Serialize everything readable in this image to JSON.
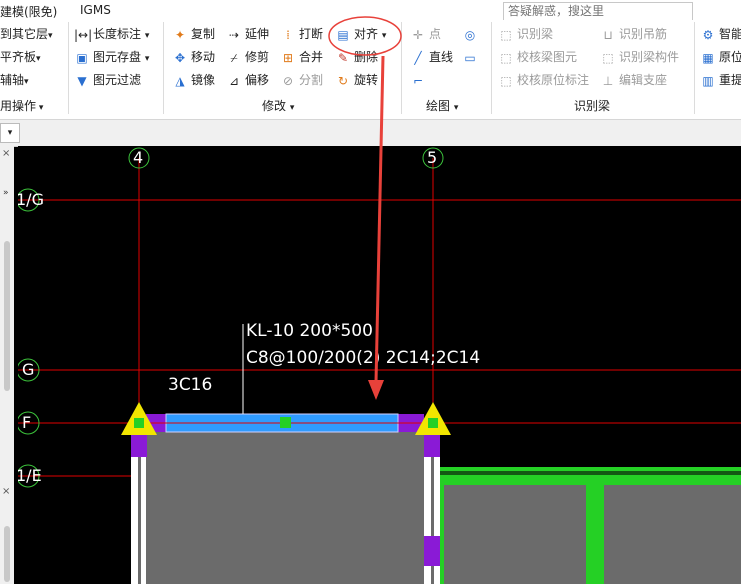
{
  "menu": {
    "tab1": "建模(限免)",
    "tab2": "IGMS",
    "search_placeholder": "答疑解惑，搜这里"
  },
  "ribbon": {
    "col1": [
      "到其它层",
      "平齐板",
      "辅轴",
      "用操作"
    ],
    "col2": [
      "长度标注",
      "图元存盘",
      "图元过滤"
    ],
    "modify": {
      "copy": "复制",
      "extend": "延伸",
      "break": "打断",
      "align": "对齐",
      "move": "移动",
      "trim": "修剪",
      "merge": "合并",
      "delete": "删除",
      "mirror": "镜像",
      "offset": "偏移",
      "split": "分割",
      "rotate": "旋转",
      "group": "修改"
    },
    "draw": {
      "point": "点",
      "line": "直线",
      "group": "绘图"
    },
    "recognize": {
      "beam": "识别梁",
      "hanger": "识别吊筋",
      "check_beam": "校核梁图元",
      "beam_member": "识别梁构件",
      "check_annot": "校核原位标注",
      "edit_support": "编辑支座",
      "group": "识别梁"
    },
    "right": [
      "智能",
      "原位",
      "重提"
    ]
  },
  "canvas": {
    "axis_top": [
      "4",
      "5"
    ],
    "axis_left": [
      "1/G",
      "G",
      "F",
      "1/E"
    ],
    "beam_label_1": "KL-10 200*500",
    "beam_label_2": "C8@100/200(2) 2C14;2C14",
    "beam_label_3": "3C16"
  },
  "colors": {
    "annotation": "#e8413a",
    "grid_line": "#e00000",
    "beam": "#2f9bff",
    "column": "#8a1ad6",
    "slab": "#6b6b6b",
    "wall": "#25d025",
    "marker": "#f2e600"
  }
}
